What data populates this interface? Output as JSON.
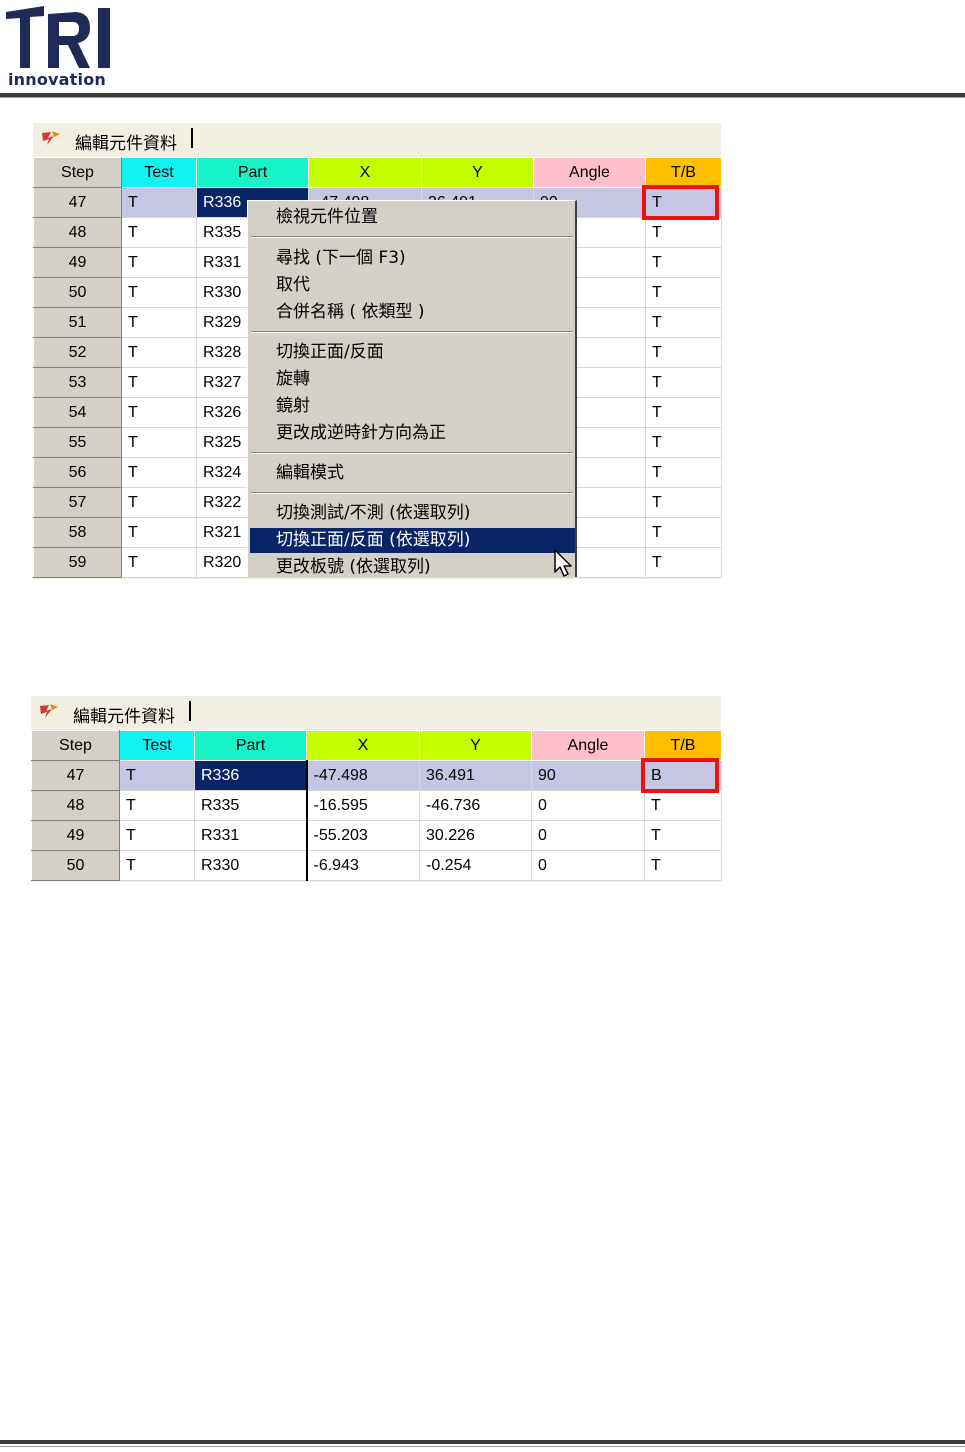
{
  "header": {
    "logo_text": "innovation",
    "logo_mark": "TRI"
  },
  "panel_title": "編輯元件資料",
  "columns": [
    "Step",
    "Test",
    "Part",
    "X",
    "Y",
    "Angle",
    "T/B"
  ],
  "top_grid": {
    "rows": [
      {
        "step": "47",
        "test": "T",
        "part": "R336",
        "x": "-47.498",
        "y": "36.491",
        "angle": "90",
        "tb": "T"
      },
      {
        "step": "48",
        "test": "T",
        "part": "R335",
        "tb": "T"
      },
      {
        "step": "49",
        "test": "T",
        "part": "R331",
        "tb": "T"
      },
      {
        "step": "50",
        "test": "T",
        "part": "R330",
        "tb": "T"
      },
      {
        "step": "51",
        "test": "T",
        "part": "R329",
        "tb": "T"
      },
      {
        "step": "52",
        "test": "T",
        "part": "R328",
        "tb": "T"
      },
      {
        "step": "53",
        "test": "T",
        "part": "R327",
        "tb": "T"
      },
      {
        "step": "54",
        "test": "T",
        "part": "R326",
        "tb": "T"
      },
      {
        "step": "55",
        "test": "T",
        "part": "R325",
        "tb": "T"
      },
      {
        "step": "56",
        "test": "T",
        "part": "R324",
        "tb": "T"
      },
      {
        "step": "57",
        "test": "T",
        "part": "R322",
        "tb": "T"
      },
      {
        "step": "58",
        "test": "T",
        "part": "R321",
        "tb": "T"
      },
      {
        "step": "59",
        "test": "T",
        "part": "R320",
        "tb": "T"
      }
    ]
  },
  "context_menu": {
    "items": [
      "檢視元件位置",
      "尋找 (下一個 F3)",
      "取代",
      "合併名稱 ( 依類型 )",
      "切換正面/反面",
      "旋轉",
      "鏡射",
      "更改成逆時針方向為正",
      "編輯模式",
      "切換測試/不測 (依選取列)",
      "切換正面/反面 (依選取列)",
      "更改板號 (依選取列)"
    ],
    "highlighted_index": 10
  },
  "bottom_grid": {
    "rows": [
      {
        "step": "47",
        "test": "T",
        "part": "R336",
        "x": "-47.498",
        "y": "36.491",
        "angle": "90",
        "tb": "B"
      },
      {
        "step": "48",
        "test": "T",
        "part": "R335",
        "x": "-16.595",
        "y": "-46.736",
        "angle": "0",
        "tb": "T"
      },
      {
        "step": "49",
        "test": "T",
        "part": "R331",
        "x": "-55.203",
        "y": "30.226",
        "angle": "0",
        "tb": "T"
      },
      {
        "step": "50",
        "test": "T",
        "part": "R330",
        "x": "-6.943",
        "y": "-0.254",
        "angle": "0",
        "tb": "T"
      }
    ]
  },
  "colors": {
    "selected_row": "#c5c6e3",
    "current_cell": "#0a2468",
    "highlight_box": "#ee1111"
  }
}
